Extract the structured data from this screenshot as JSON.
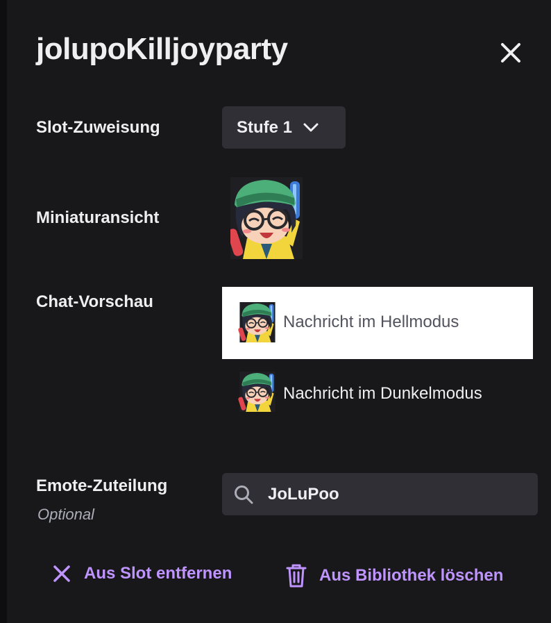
{
  "header": {
    "title": "jolupoKilljoyparty",
    "close_icon": "close-icon"
  },
  "slot": {
    "label": "Slot-Zuweisung",
    "selected": "Stufe 1",
    "chevron_icon": "chevron-down-icon"
  },
  "thumbnail": {
    "label": "Miniaturansicht",
    "emote": "emote-thumbnail"
  },
  "chat_preview": {
    "label": "Chat-Vorschau",
    "light_text": "Nachricht im Hellmodus",
    "dark_text": "Nachricht im Dunkelmodus"
  },
  "assignment": {
    "label": "Emote-Zuteilung",
    "sublabel": "Optional",
    "search_value": "JoLuPoo",
    "search_icon": "search-icon"
  },
  "actions": {
    "remove_label": "Aus Slot entfernen",
    "remove_icon": "x-icon",
    "delete_label": "Aus Bibliothek löschen",
    "delete_icon": "trash-icon"
  },
  "colors": {
    "background": "#18181b",
    "surface": "#2f2f35",
    "accent": "#bf94ff",
    "text": "#efeff1",
    "muted": "#adadb8"
  }
}
